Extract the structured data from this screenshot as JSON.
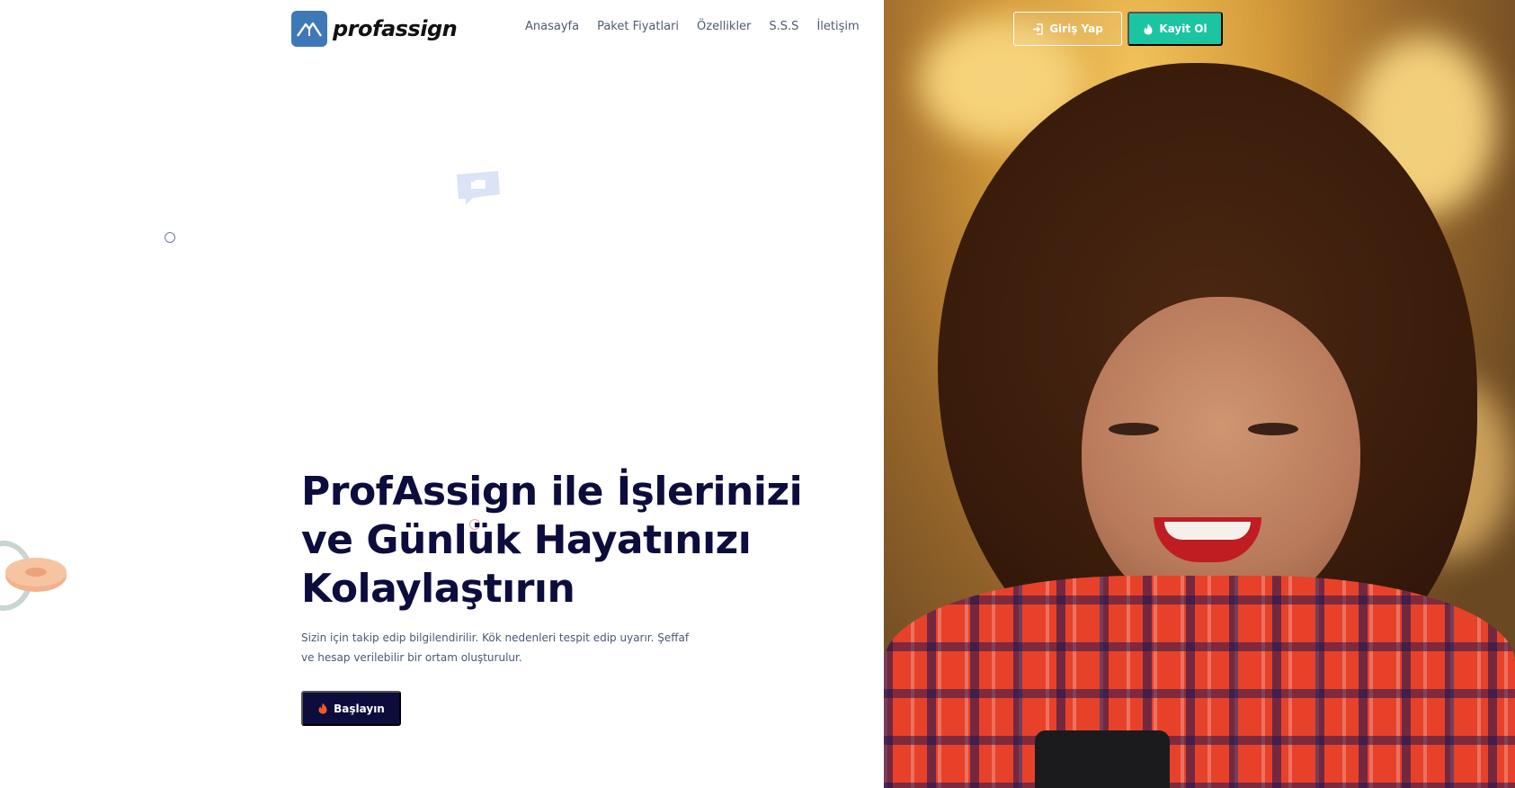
{
  "brand": {
    "name": "profassign",
    "color": "#3f78b7"
  },
  "nav": {
    "items": [
      {
        "label": "Anasayfa"
      },
      {
        "label": "Paket Fiyatlari"
      },
      {
        "label": "Özellikler"
      },
      {
        "label": "S.S.S"
      },
      {
        "label": "İletişim"
      }
    ]
  },
  "auth": {
    "login_label": "Giriş Yap",
    "login_icon": "sign-in-icon",
    "register_label": "Kayit Ol",
    "register_icon": "fire-icon",
    "register_color": "#1cc5a2"
  },
  "hero": {
    "title": "ProfAssign ile İşlerinizi\nve Günlük Hayatınızı\nKolaylaştırın",
    "description": "Sizin için takip edip bilgilendirilir. Kök nedenleri tespit edip uyarır. Şeffaf ve hesap verilebilir bir ortam oluşturulur.",
    "cta_label": "Başlayın",
    "cta_icon": "fire-icon",
    "cta_color": "#0c0c3d"
  }
}
